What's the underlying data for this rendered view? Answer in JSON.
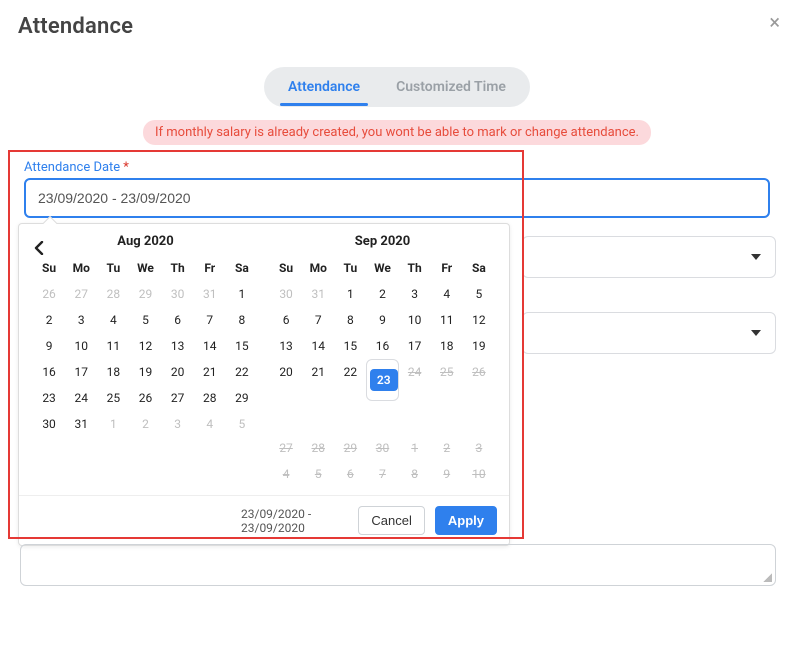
{
  "header": {
    "title": "Attendance"
  },
  "tabs": {
    "active": "Attendance",
    "other": "Customized Time"
  },
  "notice": "If monthly salary is already created, you wont be able to mark or change attendance.",
  "field": {
    "label": "Attendance Date",
    "value": "23/09/2020 - 23/09/2020"
  },
  "picker": {
    "range_text": "23/09/2020 - 23/09/2020",
    "buttons": {
      "cancel": "Cancel",
      "apply": "Apply"
    },
    "dow": [
      "Su",
      "Mo",
      "Tu",
      "We",
      "Th",
      "Fr",
      "Sa"
    ],
    "months": [
      {
        "title": "Aug 2020",
        "cells": [
          {
            "n": "26",
            "cls": "off"
          },
          {
            "n": "27",
            "cls": "off"
          },
          {
            "n": "28",
            "cls": "off"
          },
          {
            "n": "29",
            "cls": "off"
          },
          {
            "n": "30",
            "cls": "off"
          },
          {
            "n": "31",
            "cls": "off"
          },
          {
            "n": "1"
          },
          {
            "n": "2"
          },
          {
            "n": "3"
          },
          {
            "n": "4"
          },
          {
            "n": "5"
          },
          {
            "n": "6"
          },
          {
            "n": "7"
          },
          {
            "n": "8"
          },
          {
            "n": "9"
          },
          {
            "n": "10"
          },
          {
            "n": "11"
          },
          {
            "n": "12"
          },
          {
            "n": "13"
          },
          {
            "n": "14"
          },
          {
            "n": "15"
          },
          {
            "n": "16"
          },
          {
            "n": "17"
          },
          {
            "n": "18"
          },
          {
            "n": "19"
          },
          {
            "n": "20"
          },
          {
            "n": "21"
          },
          {
            "n": "22"
          },
          {
            "n": "23"
          },
          {
            "n": "24"
          },
          {
            "n": "25"
          },
          {
            "n": "26"
          },
          {
            "n": "27"
          },
          {
            "n": "28"
          },
          {
            "n": "29"
          },
          {
            "n": "30"
          },
          {
            "n": "31"
          },
          {
            "n": "1",
            "cls": "off"
          },
          {
            "n": "2",
            "cls": "off"
          },
          {
            "n": "3",
            "cls": "off"
          },
          {
            "n": "4",
            "cls": "off"
          },
          {
            "n": "5",
            "cls": "off"
          }
        ]
      },
      {
        "title": "Sep 2020",
        "cells": [
          {
            "n": "30",
            "cls": "off"
          },
          {
            "n": "31",
            "cls": "off"
          },
          {
            "n": "1"
          },
          {
            "n": "2"
          },
          {
            "n": "3"
          },
          {
            "n": "4"
          },
          {
            "n": "5"
          },
          {
            "n": "6"
          },
          {
            "n": "7"
          },
          {
            "n": "8"
          },
          {
            "n": "9"
          },
          {
            "n": "10"
          },
          {
            "n": "11"
          },
          {
            "n": "12"
          },
          {
            "n": "13"
          },
          {
            "n": "14"
          },
          {
            "n": "15"
          },
          {
            "n": "16"
          },
          {
            "n": "17"
          },
          {
            "n": "18"
          },
          {
            "n": "19"
          },
          {
            "n": "20"
          },
          {
            "n": "21"
          },
          {
            "n": "22"
          },
          {
            "n": "23",
            "cls": "sel"
          },
          {
            "n": "24",
            "cls": "strike"
          },
          {
            "n": "25",
            "cls": "strike"
          },
          {
            "n": "26",
            "cls": "strike"
          },
          {
            "n": "27",
            "cls": "strike"
          },
          {
            "n": "28",
            "cls": "strike"
          },
          {
            "n": "29",
            "cls": "strike"
          },
          {
            "n": "30",
            "cls": "strike"
          },
          {
            "n": "1",
            "cls": "strike"
          },
          {
            "n": "2",
            "cls": "strike"
          },
          {
            "n": "3",
            "cls": "strike"
          },
          {
            "n": "4",
            "cls": "strike"
          },
          {
            "n": "5",
            "cls": "strike"
          },
          {
            "n": "6",
            "cls": "strike"
          },
          {
            "n": "7",
            "cls": "strike"
          },
          {
            "n": "8",
            "cls": "strike"
          },
          {
            "n": "9",
            "cls": "strike"
          },
          {
            "n": "10",
            "cls": "strike"
          }
        ]
      }
    ]
  }
}
